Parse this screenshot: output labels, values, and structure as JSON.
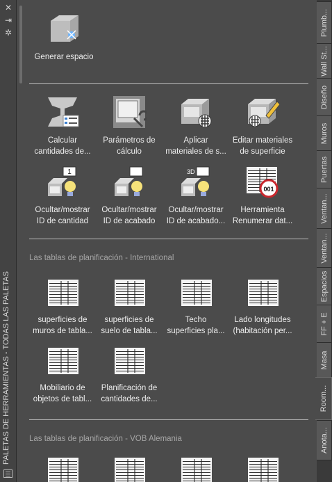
{
  "palette_title": "PALETAS DE HERRAMIENTAS - TODAS LAS PALETAS",
  "strip_controls": {
    "close": "✕",
    "autohide": "⇥",
    "properties": "✲"
  },
  "sections": {
    "top": [
      {
        "label": "Generar espacio",
        "icon": "generate-space-icon"
      }
    ],
    "tools": [
      {
        "label1": "Calcular",
        "label2": "cantidades  de...",
        "icon": "calculate-quantities-icon"
      },
      {
        "label1": "Parámetros de",
        "label2": "cálculo",
        "icon": "calculation-parameters-icon"
      },
      {
        "label1": "Aplicar",
        "label2": "materiales  de  s...",
        "icon": "apply-materials-icon"
      },
      {
        "label1": "Editar materiales",
        "label2": "de superficie",
        "icon": "edit-materials-icon"
      },
      {
        "label1": "Ocultar/mostrar",
        "label2": "ID de cantidad",
        "icon": "show-quantity-id-icon"
      },
      {
        "label1": "Ocultar/mostrar",
        "label2": "ID de acabado",
        "icon": "show-finish-id-icon"
      },
      {
        "label1": "Ocultar/mostrar",
        "label2": "ID de acabado...",
        "icon": "show-finish-id-3d-icon"
      },
      {
        "label1": "Herramienta",
        "label2": "Renumerar  dat...",
        "icon": "renumber-tool-icon"
      }
    ],
    "international": {
      "title": "Las tablas de planificación - International",
      "items": [
        {
          "label1": "superficies de",
          "label2": "muros de tabla..."
        },
        {
          "label1": "superficies de",
          "label2": "suelo de tabla..."
        },
        {
          "label1": "Techo",
          "label2": "superficies pla..."
        },
        {
          "label1": "Lado longitudes",
          "label2": "(habitación per..."
        },
        {
          "label1": "Mobiliario de",
          "label2": "objetos de tabl..."
        },
        {
          "label1": "Planificación de",
          "label2": "cantidades  de..."
        }
      ]
    },
    "vob": {
      "title": "Las tablas de planificación - VOB Alemania"
    }
  },
  "icon_texts": {
    "badge_1": "1",
    "badge_3d": "3D",
    "badge_001": "001"
  },
  "tabs": [
    "Plumb...",
    "Wall St...",
    "Diseño",
    "Muros",
    "Puertas",
    "Ventan...",
    "Ventan...",
    "Espacios",
    "FF + E",
    "Masa",
    "Room...",
    "Anota..."
  ],
  "active_tab": "Room...",
  "colors": {
    "panel": "#4b4b4b",
    "tab": "#585858",
    "accent_blue": "#3a7fd0",
    "badge_red": "#c8272d"
  }
}
